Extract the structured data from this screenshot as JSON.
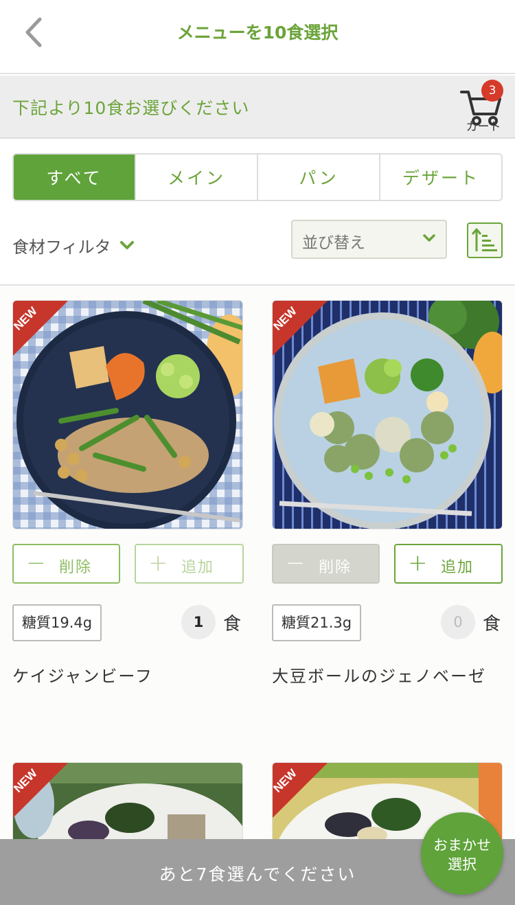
{
  "header": {
    "title": "メニューを10食選択"
  },
  "info": {
    "text": "下記より10食お選びください",
    "cart_label": "カート",
    "cart_count": "3"
  },
  "tabs": [
    {
      "label": "すべて",
      "active": true
    },
    {
      "label": "メイン",
      "active": false
    },
    {
      "label": "パン",
      "active": false
    },
    {
      "label": "デザート",
      "active": false
    }
  ],
  "filter": {
    "label": "食材フィルタ"
  },
  "sort": {
    "label": "並び替え"
  },
  "products": [
    {
      "name": "ケイジャンビーフ",
      "carb": "糖質19.4g",
      "qty": "1",
      "unit": "食",
      "remove": "削除",
      "add": "追加",
      "badge": "NEW"
    },
    {
      "name": "大豆ボールのジェノベーゼ",
      "carb": "糖質21.3g",
      "qty": "0",
      "unit": "食",
      "remove": "削除",
      "add": "追加",
      "badge": "NEW"
    },
    {
      "badge": "NEW"
    },
    {
      "badge": "NEW"
    }
  ],
  "bottom": {
    "text": "あと7食選んでください",
    "omakase_line1": "おまかせ",
    "omakase_line2": "選択"
  },
  "colors": {
    "green": "#5fa33a",
    "badge_red": "#d63a2a",
    "bottom_gray": "#9e9e9e"
  }
}
